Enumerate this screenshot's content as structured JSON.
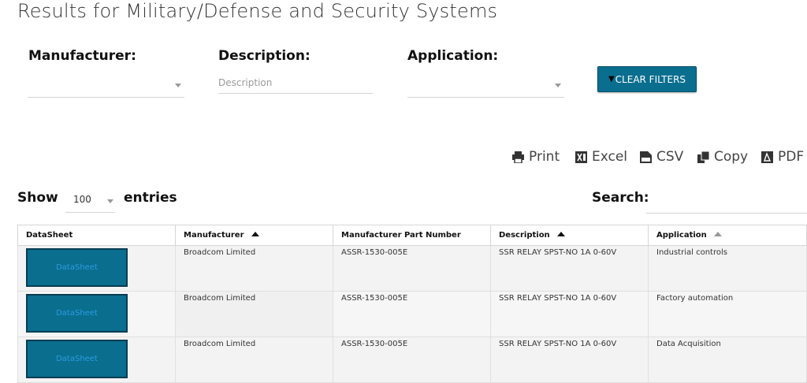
{
  "page": {
    "title": "Results for Military/Defense and Security Systems"
  },
  "filters": {
    "manufacturer_label": "Manufacturer:",
    "description_label": "Description:",
    "description_placeholder": "Description",
    "application_label": "Application:",
    "clear_label": "CLEAR FILTERS"
  },
  "exports": {
    "print": "Print",
    "excel": "Excel",
    "csv": "CSV",
    "copy": "Copy",
    "pdf": "PDF"
  },
  "table_controls": {
    "show_label": "Show",
    "page_length": "100",
    "entries_label": "entries",
    "search_label": "Search:"
  },
  "table": {
    "columns": [
      "DataSheet",
      "Manufacturer",
      "Manufacturer Part Number",
      "Description",
      "Application"
    ],
    "rows": [
      {
        "datasheet": "DataSheet",
        "manufacturer": "Broadcom Limited",
        "part_number": "ASSR-1530-005E",
        "description": "SSR RELAY SPST-NO 1A 0-60V",
        "application": "Industrial controls"
      },
      {
        "datasheet": "DataSheet",
        "manufacturer": "Broadcom Limited",
        "part_number": "ASSR-1530-005E",
        "description": "SSR RELAY SPST-NO 1A 0-60V",
        "application": "Factory automation"
      },
      {
        "datasheet": "DataSheet",
        "manufacturer": "Broadcom Limited",
        "part_number": "ASSR-1530-005E",
        "description": "SSR RELAY SPST-NO 1A 0-60V",
        "application": "Data Acquisition"
      }
    ]
  },
  "colors": {
    "accent": "#0a6e8f",
    "link": "#2d9be0"
  }
}
